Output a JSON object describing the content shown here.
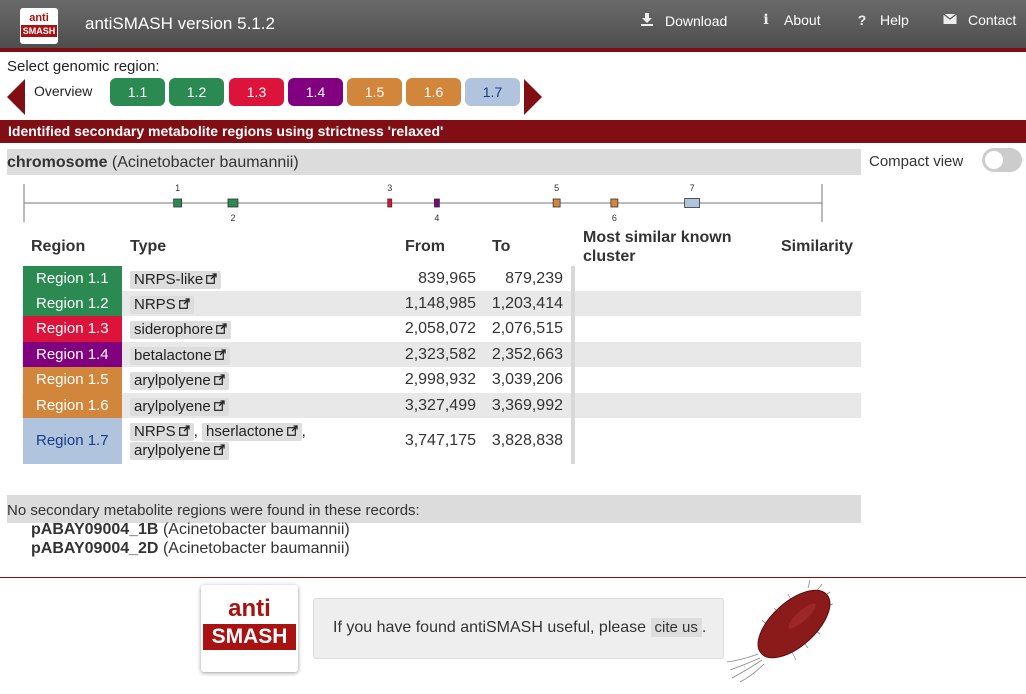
{
  "header": {
    "logo_top": "anti",
    "logo_bottom": "SMASH",
    "title": "antiSMASH version 5.1.2",
    "nav": [
      {
        "icon": "download-icon",
        "label": "Download"
      },
      {
        "icon": "info-icon",
        "label": "About"
      },
      {
        "icon": "help-icon",
        "label": "Help"
      },
      {
        "icon": "envelope-icon",
        "label": "Contact"
      }
    ]
  },
  "selector": {
    "label": "Select genomic region:",
    "overview_label": "Overview",
    "regions": [
      {
        "label": "1.1",
        "color": "#2b8a52"
      },
      {
        "label": "1.2",
        "color": "#2b8a52"
      },
      {
        "label": "1.3",
        "color": "#dc143c"
      },
      {
        "label": "1.4",
        "color": "#800080"
      },
      {
        "label": "1.5",
        "color": "#d2863c"
      },
      {
        "label": "1.6",
        "color": "#d2863c"
      },
      {
        "label": "1.7",
        "color": "#b0c4de"
      }
    ]
  },
  "section_title": "Identified secondary metabolite regions using strictness 'relaxed'",
  "record": {
    "name": "chromosome",
    "organism": "(Acinetobacter baumannii)"
  },
  "compact_view_label": "Compact view",
  "overview_markers": [
    {
      "label": "1",
      "position_bp": 839965,
      "color": "#2b8a52",
      "label_side": "top"
    },
    {
      "label": "2",
      "position_bp": 1148985,
      "color": "#2b8a52",
      "label_side": "bottom"
    },
    {
      "label": "3",
      "position_bp": 2058072,
      "color": "#dc143c",
      "label_side": "top"
    },
    {
      "label": "4",
      "position_bp": 2323582,
      "color": "#800080",
      "label_side": "bottom"
    },
    {
      "label": "5",
      "position_bp": 2998932,
      "color": "#d2863c",
      "label_side": "top"
    },
    {
      "label": "6",
      "position_bp": 3327499,
      "color": "#d2863c",
      "label_side": "bottom"
    },
    {
      "label": "7",
      "position_bp": 3747175,
      "color": "#b0c4de",
      "label_side": "top"
    }
  ],
  "table": {
    "headers": {
      "region": "Region",
      "type": "Type",
      "from": "From",
      "to": "To",
      "most_similar": "Most similar known cluster",
      "similarity": "Similarity"
    },
    "rows": [
      {
        "region": "Region 1.1",
        "color": "#2b8a52",
        "text_color": "#ffffff",
        "types": [
          "NRPS-like"
        ],
        "from": "839,965",
        "to": "879,239"
      },
      {
        "region": "Region 1.2",
        "color": "#2b8a52",
        "text_color": "#ffffff",
        "types": [
          "NRPS"
        ],
        "from": "1,148,985",
        "to": "1,203,414"
      },
      {
        "region": "Region 1.3",
        "color": "#dc143c",
        "text_color": "#ffffff",
        "types": [
          "siderophore"
        ],
        "from": "2,058,072",
        "to": "2,076,515"
      },
      {
        "region": "Region 1.4",
        "color": "#800080",
        "text_color": "#ffffff",
        "types": [
          "betalactone"
        ],
        "from": "2,323,582",
        "to": "2,352,663"
      },
      {
        "region": "Region 1.5",
        "color": "#d2863c",
        "text_color": "#ffffff",
        "types": [
          "arylpolyene"
        ],
        "from": "2,998,932",
        "to": "3,039,206"
      },
      {
        "region": "Region 1.6",
        "color": "#d2863c",
        "text_color": "#ffffff",
        "types": [
          "arylpolyene"
        ],
        "from": "3,327,499",
        "to": "3,369,992"
      },
      {
        "region": "Region 1.7",
        "color": "#b0c4de",
        "text_color": "#1a3a8a",
        "types": [
          "NRPS",
          "hserlactone",
          "arylpolyene"
        ],
        "from": "3,747,175",
        "to": "3,828,838"
      }
    ]
  },
  "no_regions": {
    "heading": "No secondary metabolite regions were found in these records:",
    "records": [
      {
        "name": "pABAY09004_1B",
        "organism": "(Acinetobacter baumannii)"
      },
      {
        "name": "pABAY09004_2D",
        "organism": "(Acinetobacter baumannii)"
      }
    ]
  },
  "footer": {
    "logo_top": "anti",
    "logo_bottom": "SMASH",
    "cite_text": "If you have found antiSMASH useful, please",
    "cite_button": "cite us",
    "cite_suffix": "."
  }
}
